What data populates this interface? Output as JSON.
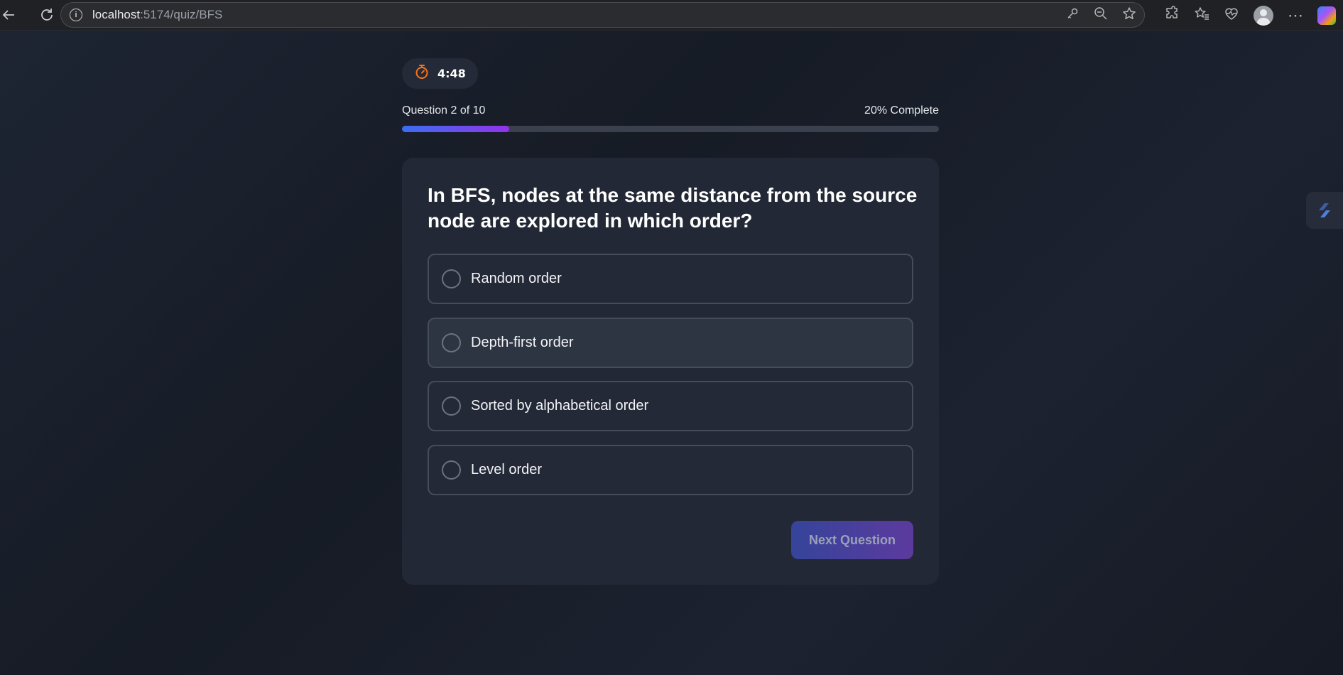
{
  "browser": {
    "url_host": "localhost",
    "url_path": ":5174/quiz/BFS"
  },
  "quiz": {
    "timer": "4:48",
    "progress_label": "Question 2 of 10",
    "progress_percent_label": "20% Complete",
    "progress_fraction": 0.2,
    "question": "In BFS, nodes at the same distance from the source node are explored in which order?",
    "options": [
      {
        "label": "Random order"
      },
      {
        "label": "Depth-first order"
      },
      {
        "label": "Sorted by alphabetical order"
      },
      {
        "label": "Level order"
      }
    ],
    "next_label": "Next Question"
  },
  "colors": {
    "accent_start": "#3b6ef0",
    "accent_end": "#9333ea",
    "timer_icon": "#f97316"
  },
  "icons": [
    "back-icon",
    "reload-icon",
    "info-icon",
    "key-icon",
    "zoom-out-icon",
    "star-icon",
    "extensions-icon",
    "favorites-icon",
    "health-icon",
    "profile-icon",
    "more-icon",
    "copilot-icon",
    "stopwatch-icon"
  ]
}
